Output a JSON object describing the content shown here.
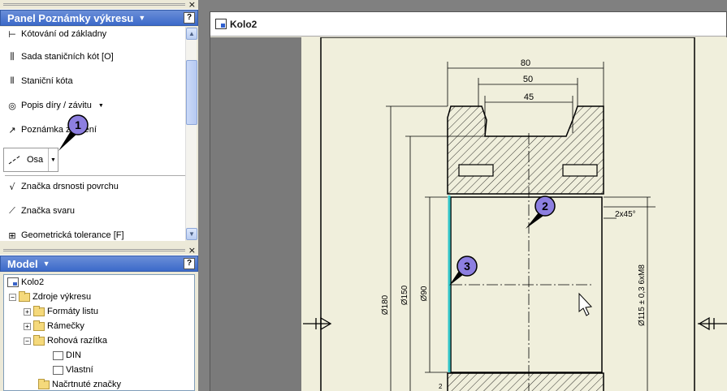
{
  "tool_panel": {
    "title": "Panel Poznámky výkresu",
    "help": "?",
    "close": "×",
    "tools": [
      {
        "label": "Kótování od základny",
        "icon": "baseline-dimension-icon"
      },
      {
        "label": "Sada staničních kót  [O]",
        "icon": "ordinate-set-icon"
      },
      {
        "label": "Staniční kóta",
        "icon": "ordinate-dimension-icon"
      },
      {
        "label": "Popis díry / závitu",
        "icon": "hole-thread-note-icon"
      },
      {
        "label": "Poznámka zkosení",
        "icon": "chamfer-note-icon"
      }
    ],
    "split_button": {
      "label": "Osa",
      "icon": "centerline-icon"
    },
    "tools_after": [
      {
        "label": "Značka drsnosti povrchu",
        "icon": "surface-texture-icon"
      },
      {
        "label": "Značka svaru",
        "icon": "weld-symbol-icon"
      },
      {
        "label": "Geometrická tolerance  [F]",
        "icon": "geometric-tolerance-icon"
      }
    ]
  },
  "model_panel": {
    "title": "Model",
    "help": "?",
    "close": "×",
    "tree": [
      {
        "label": "Kolo2"
      },
      {
        "label": "Zdroje výkresu"
      },
      {
        "label": "Formáty listu"
      },
      {
        "label": "Rámečky"
      },
      {
        "label": "Rohová razítka"
      },
      {
        "label": "DIN"
      },
      {
        "label": "Vlastní"
      },
      {
        "label": "Načrtnuté značky"
      }
    ]
  },
  "document_window": {
    "title": "Kolo2"
  },
  "drawing": {
    "dim_80": "80",
    "dim_50": "50",
    "dim_45": "45",
    "dim_180": "Ø180",
    "dim_150": "Ø150",
    "dim_90": "Ø90",
    "dim_chamfer": "2x45°",
    "dim_bore": "Ø115 ± 0,3 6xM8",
    "small_2": "2"
  },
  "callouts": {
    "one": "1",
    "two": "2",
    "three": "3"
  },
  "colors": {
    "sheet_bg": "#f0efdc",
    "title_gradient_top": "#6a8ed8",
    "title_gradient_bottom": "#3c6ac9",
    "bubble": "#8d7fe0",
    "highlight": "#33c6c9"
  }
}
